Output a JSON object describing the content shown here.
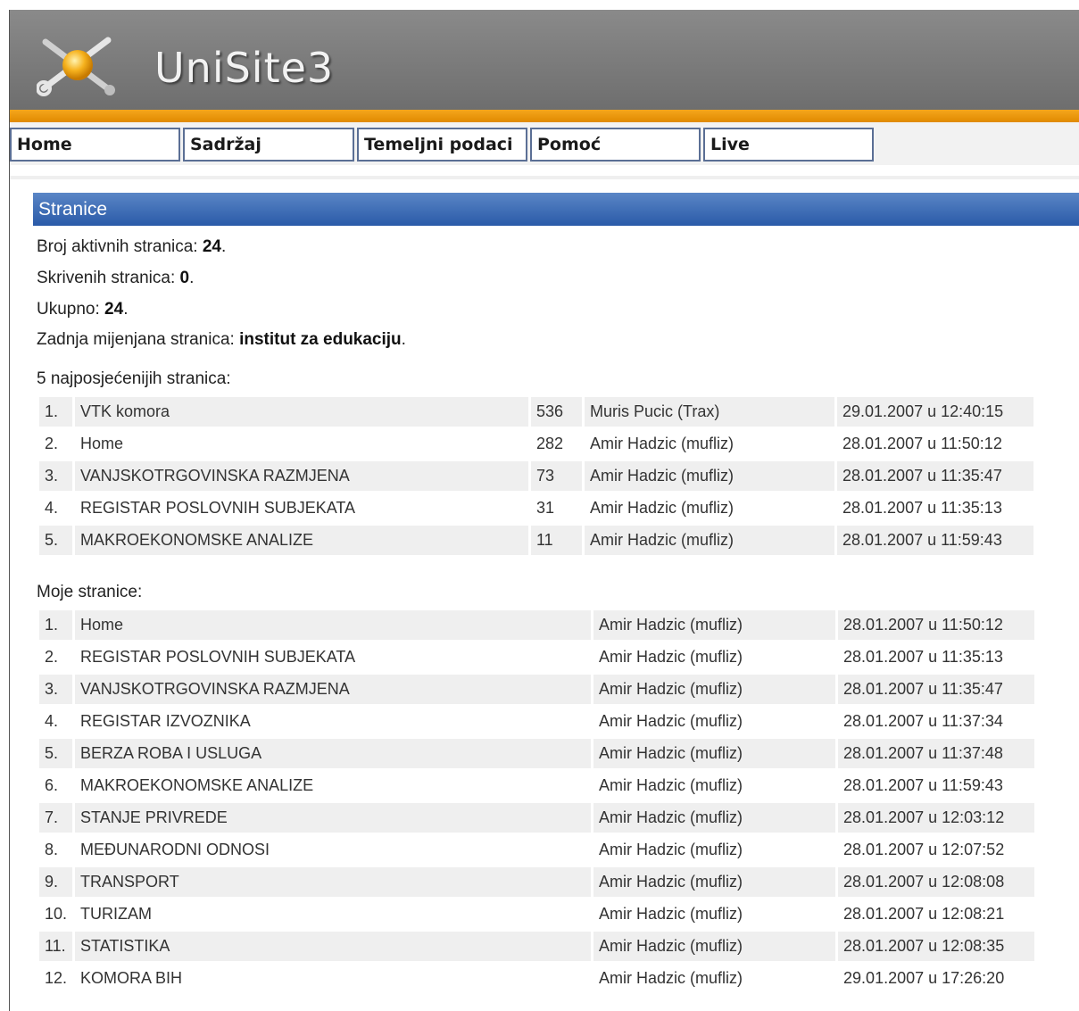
{
  "header": {
    "brand": "UniSite3"
  },
  "nav": [
    {
      "label": "Home"
    },
    {
      "label": "Sadržaj"
    },
    {
      "label": "Temeljni podaci"
    },
    {
      "label": "Pomoć"
    },
    {
      "label": "Live"
    }
  ],
  "section": {
    "title": "Stranice"
  },
  "stats": {
    "active_label": "Broj aktivnih stranica: ",
    "active_value": "24",
    "hidden_label": "Skrivenih stranica: ",
    "hidden_value": "0",
    "total_label": "Ukupno: ",
    "total_value": "24",
    "last_label": "Zadnja mijenjana stranica: ",
    "last_value": "institut za edukaciju",
    "suffix": "."
  },
  "top_pages": {
    "caption": "5 najposjećenijih stranica:",
    "rows": [
      {
        "num": "1.",
        "name": "VTK komora",
        "count": "536",
        "user": "Muris Pucic (Trax)",
        "date": "29.01.2007 u 12:40:15"
      },
      {
        "num": "2.",
        "name": "Home",
        "count": "282",
        "user": "Amir Hadzic (mufliz)",
        "date": "28.01.2007 u 11:50:12"
      },
      {
        "num": "3.",
        "name": "VANJSKOTRGOVINSKA RAZMJENA",
        "count": "73",
        "user": "Amir Hadzic (mufliz)",
        "date": "28.01.2007 u 11:35:47"
      },
      {
        "num": "4.",
        "name": "REGISTAR POSLOVNIH SUBJEKATA",
        "count": "31",
        "user": "Amir Hadzic (mufliz)",
        "date": "28.01.2007 u 11:35:13"
      },
      {
        "num": "5.",
        "name": "MAKROEKONOMSKE ANALIZE",
        "count": "11",
        "user": "Amir Hadzic (mufliz)",
        "date": "28.01.2007 u 11:59:43"
      }
    ]
  },
  "my_pages": {
    "caption": "Moje stranice:",
    "rows": [
      {
        "num": "1.",
        "name": "Home",
        "user": "Amir Hadzic (mufliz)",
        "date": "28.01.2007 u 11:50:12"
      },
      {
        "num": "2.",
        "name": "REGISTAR POSLOVNIH SUBJEKATA",
        "user": "Amir Hadzic (mufliz)",
        "date": "28.01.2007 u 11:35:13"
      },
      {
        "num": "3.",
        "name": "VANJSKOTRGOVINSKA RAZMJENA",
        "user": "Amir Hadzic (mufliz)",
        "date": "28.01.2007 u 11:35:47"
      },
      {
        "num": "4.",
        "name": "REGISTAR IZVOZNIKA",
        "user": "Amir Hadzic (mufliz)",
        "date": "28.01.2007 u 11:37:34"
      },
      {
        "num": "5.",
        "name": "BERZA ROBA I USLUGA",
        "user": "Amir Hadzic (mufliz)",
        "date": "28.01.2007 u 11:37:48"
      },
      {
        "num": "6.",
        "name": "MAKROEKONOMSKE ANALIZE",
        "user": "Amir Hadzic (mufliz)",
        "date": "28.01.2007 u 11:59:43"
      },
      {
        "num": "7.",
        "name": "STANJE PRIVREDE",
        "user": "Amir Hadzic (mufliz)",
        "date": "28.01.2007 u 12:03:12"
      },
      {
        "num": "8.",
        "name": "MEĐUNARODNI ODNOSI",
        "user": "Amir Hadzic (mufliz)",
        "date": "28.01.2007 u 12:07:52"
      },
      {
        "num": "9.",
        "name": "TRANSPORT",
        "user": "Amir Hadzic (mufliz)",
        "date": "28.01.2007 u 12:08:08"
      },
      {
        "num": "10.",
        "name": "TURIZAM",
        "user": "Amir Hadzic (mufliz)",
        "date": "28.01.2007 u 12:08:21"
      },
      {
        "num": "11.",
        "name": "STATISTIKA",
        "user": "Amir Hadzic (mufliz)",
        "date": "28.01.2007 u 12:08:35"
      },
      {
        "num": "12.",
        "name": "KOMORA BIH",
        "user": "Amir Hadzic (mufliz)",
        "date": "29.01.2007 u 17:26:20"
      }
    ]
  }
}
